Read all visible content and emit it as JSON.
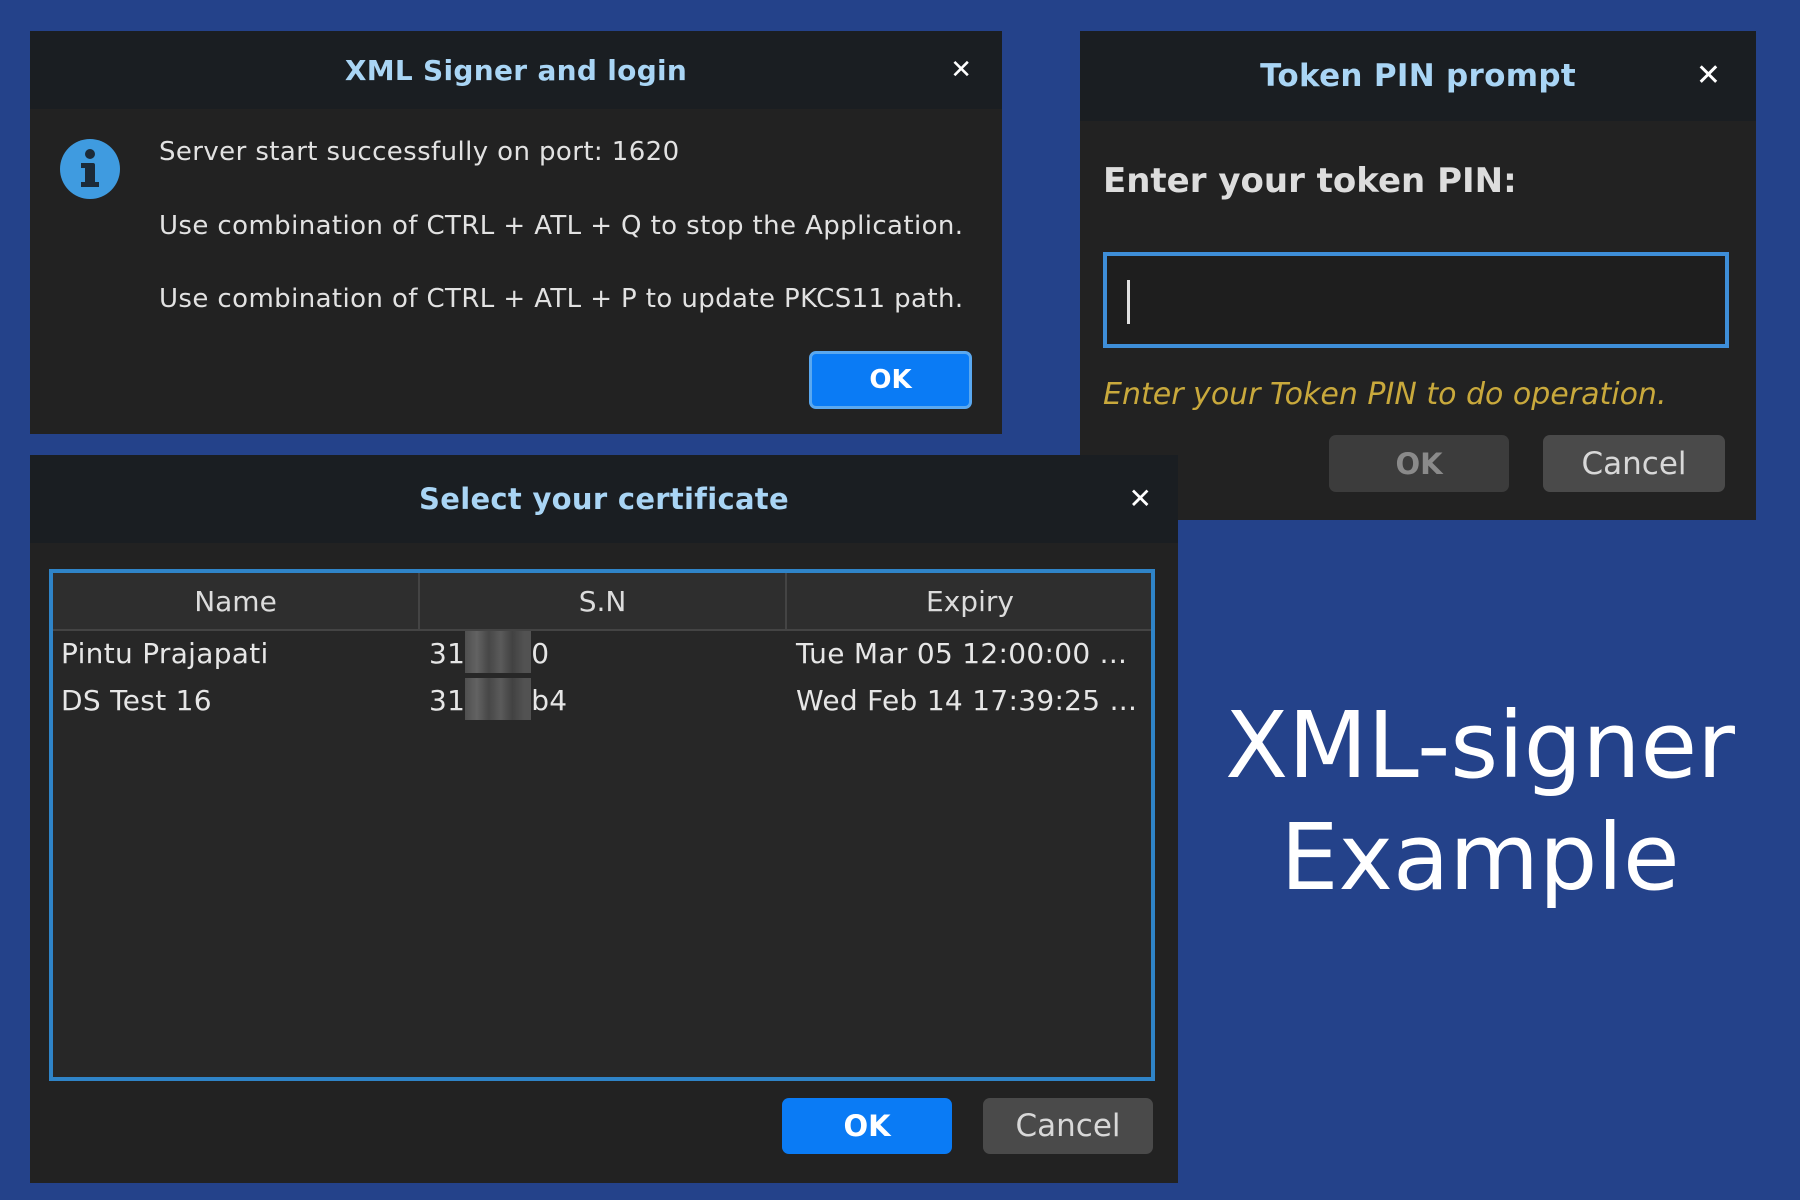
{
  "login_dialog": {
    "title": "XML Signer and login",
    "close_glyph": "✕",
    "info_icon": "info-icon",
    "messages": [
      "Server start successfully on port: 1620",
      "Use combination of CTRL + ATL + Q to stop the Application.",
      "Use combination of CTRL + ATL + P to update PKCS11 path."
    ],
    "ok_label": "OK"
  },
  "token_dialog": {
    "title": "Token PIN prompt",
    "close_glyph": "✕",
    "prompt_label": "Enter your token PIN:",
    "pin_value": "",
    "hint": "Enter your Token PIN to do operation.",
    "ok_label": "OK",
    "cancel_label": "Cancel"
  },
  "cert_dialog": {
    "title": "Select your certificate",
    "close_glyph": "✕",
    "columns": [
      "Name",
      "S.N",
      "Expiry"
    ],
    "rows": [
      {
        "name": "Pintu Prajapati",
        "sn_prefix": "31",
        "sn_suffix": "0",
        "expiry": "Tue Mar 05 12:00:00 ..."
      },
      {
        "name": "DS Test 16",
        "sn_prefix": "31",
        "sn_suffix": "b4",
        "expiry": "Wed Feb 14 17:39:25 ..."
      }
    ],
    "ok_label": "OK",
    "cancel_label": "Cancel"
  },
  "caption": {
    "line1": "XML-signer",
    "line2": "Example"
  },
  "colors": {
    "background": "#24428a",
    "accent": "#0a7bf5",
    "title_text": "#a9d5f5",
    "hint_text": "#c9a93c"
  }
}
